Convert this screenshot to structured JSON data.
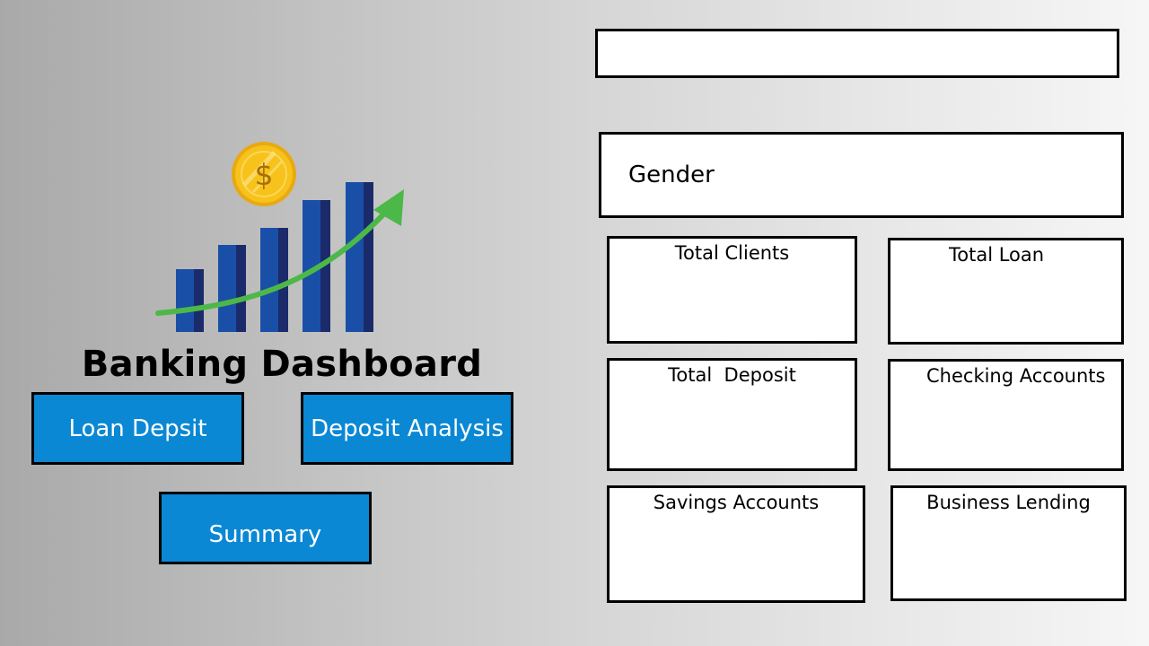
{
  "header": {
    "title": "Banking Dashboard"
  },
  "logo": {
    "coin_symbol": "$",
    "bar_color": "#1a4fa8",
    "bar_shadow_color": "#1b2a6b",
    "arrow_color": "#4cb848",
    "coin_color": "#f7c21a"
  },
  "navigation": {
    "loan_label": "Loan Depsit",
    "deposit_label": "Deposit Analysis",
    "summary_label": "Summary",
    "button_color": "#0a88d4"
  },
  "filters": {
    "gender_label": "Gender"
  },
  "kpi_cards": {
    "total_clients": "Total Clients",
    "total_loan": "Total Loan",
    "total_deposit": "Total  Deposit",
    "checking_accounts": "Checking Accounts",
    "savings_accounts": "Savings Accounts",
    "business_lending": "Business Lending"
  }
}
